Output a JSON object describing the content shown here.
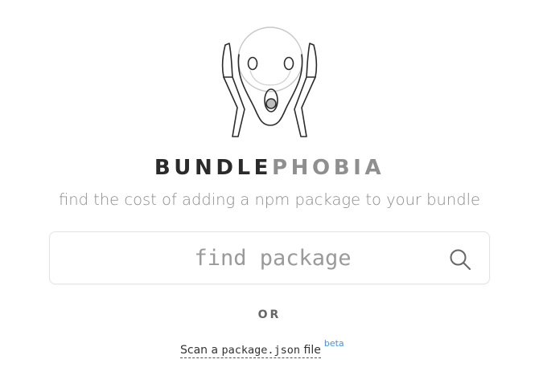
{
  "brand": {
    "name_part1": "BUNDLE",
    "name_part2": "PHOBIA",
    "tagline": "find the cost of adding a npm package to your bundle",
    "logo_icon": "screaming-face-logo"
  },
  "search": {
    "placeholder": "find package",
    "value": "",
    "icon": "search-icon"
  },
  "separator": {
    "label": "OR"
  },
  "scan": {
    "prefix": "Scan a ",
    "filename": "package.json",
    "suffix": " file",
    "badge": "beta"
  },
  "colors": {
    "brand_dark": "#2a2a2a",
    "brand_light": "#8f8f8f",
    "beta_badge": "#4a90d9"
  }
}
